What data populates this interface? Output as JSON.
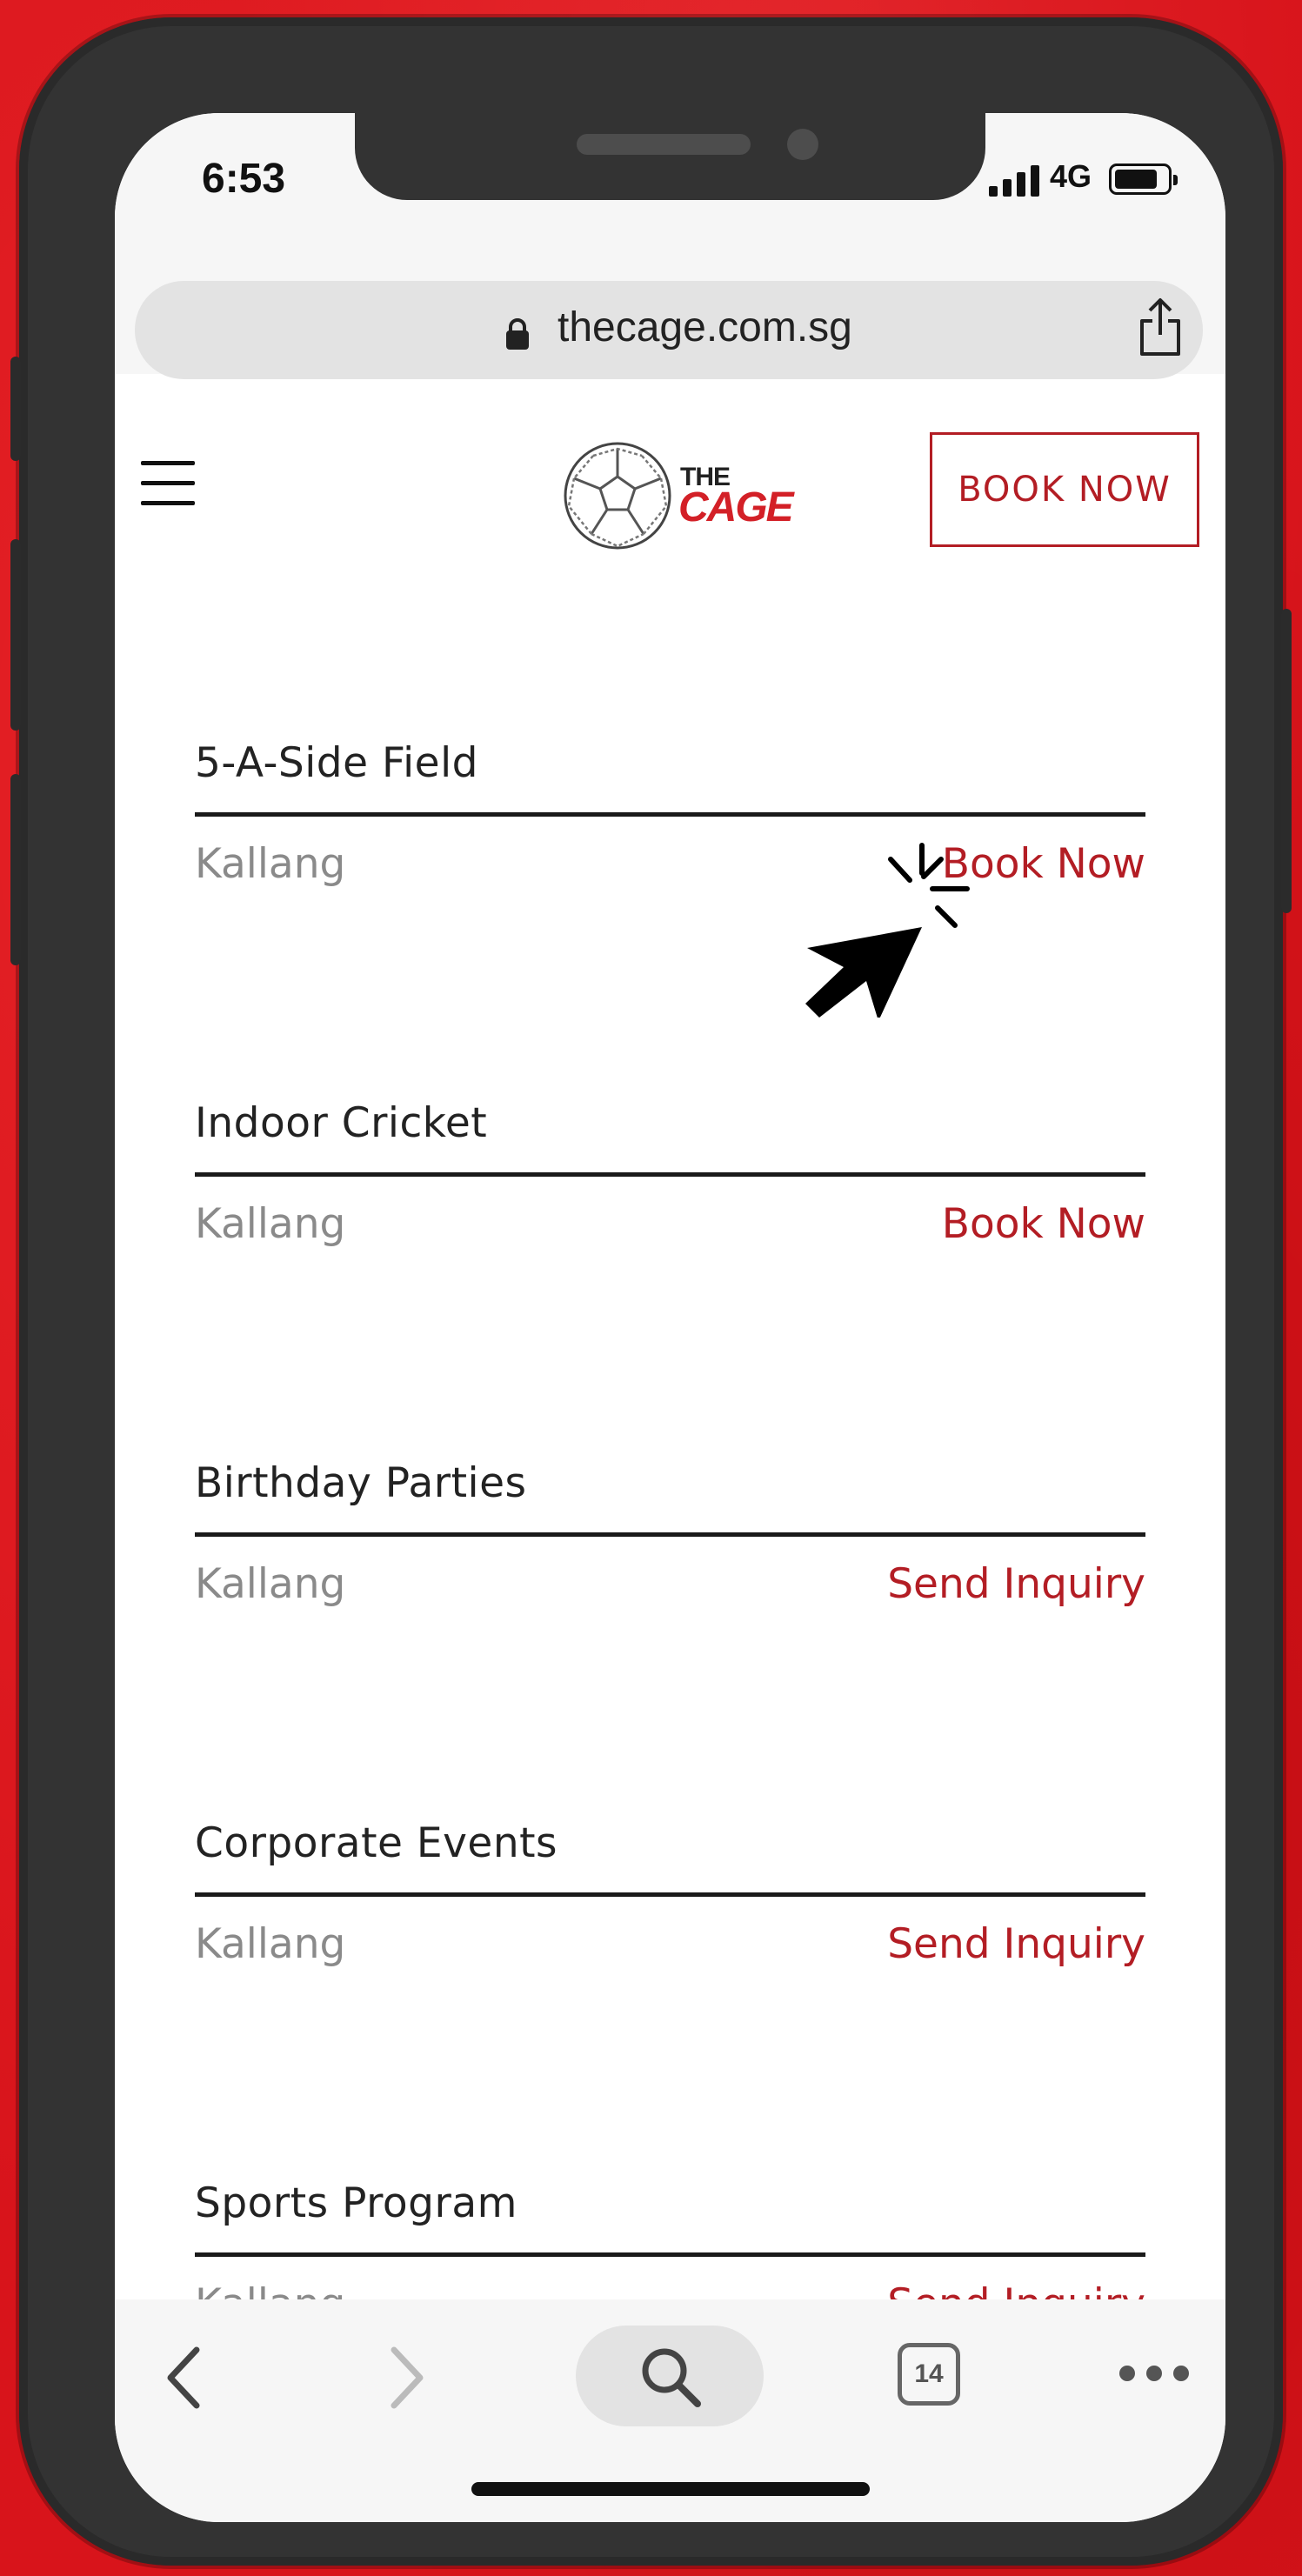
{
  "status_bar": {
    "time": "6:53",
    "network": "4G"
  },
  "browser": {
    "url": "thecage.com.sg",
    "tab_count": "14"
  },
  "header": {
    "logo_line1": "THE",
    "logo_line2": "CAGE",
    "book_button": "BOOK NOW"
  },
  "items": [
    {
      "title": "5-A-Side Field",
      "location": "Kallang",
      "action": "Book Now"
    },
    {
      "title": "Indoor Cricket",
      "location": "Kallang",
      "action": "Book Now"
    },
    {
      "title": "Birthday Parties",
      "location": "Kallang",
      "action": "Send Inquiry"
    },
    {
      "title": "Corporate Events",
      "location": "Kallang",
      "action": "Send Inquiry"
    },
    {
      "title": "Sports Program",
      "location": "Kallang",
      "action": "Send Inquiry"
    }
  ],
  "colors": {
    "background": "#d8141b",
    "accent": "#b31d24",
    "phone_frame": "#333333"
  },
  "icons": [
    "lock-icon",
    "share-icon",
    "hamburger-icon",
    "back-icon",
    "forward-icon",
    "search-icon",
    "tabs-icon",
    "more-icon",
    "pointer-cursor-icon"
  ]
}
